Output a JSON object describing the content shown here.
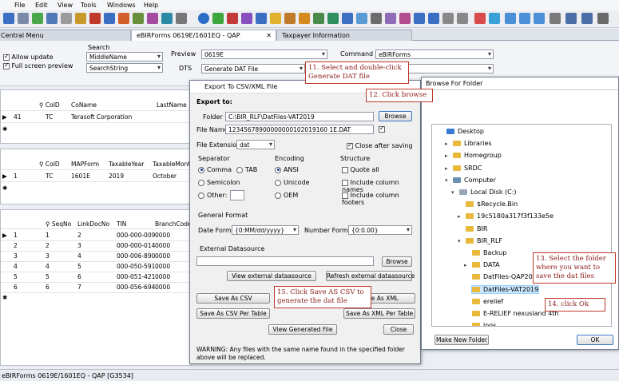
{
  "menu": [
    "File",
    "Edit",
    "View",
    "Tools",
    "Windows",
    "Help"
  ],
  "tabs": [
    "Central Menu",
    "eBIRForms 0619E/1601EQ - QAP",
    "Taxpayer Information"
  ],
  "filter": {
    "allow_update": "Allow update",
    "full_screen": "Full screen preview",
    "search_label": "Search",
    "search_field": "MiddleName",
    "search_string": "SearchString",
    "preview_label": "Preview",
    "preview_value": "0619E",
    "command_label": "Command",
    "command_value": "eBIRForms",
    "dts_label": "DTS",
    "dts_value": "Generate DAT File"
  },
  "grid1": {
    "headers": [
      "CoID",
      "CoName",
      "LastName"
    ],
    "rows": [
      [
        "41",
        "TC",
        "Terasoft Corporation"
      ]
    ]
  },
  "grid2": {
    "headers": [
      "CoID",
      "MAPForm",
      "TaxableYear",
      "TaxableMonth"
    ],
    "rows": [
      [
        "1",
        "TC",
        "1601E",
        "2019",
        "October"
      ]
    ]
  },
  "grid3": {
    "headers": [
      "SeqNo",
      "LinkDocNo",
      "TIN",
      "BranchCode"
    ],
    "rows": [
      [
        "1",
        "2",
        "000-000-009",
        "0000"
      ],
      [
        "2",
        "3",
        "000-000-014",
        "0000"
      ],
      [
        "3",
        "4",
        "000-006-890",
        "0000"
      ],
      [
        "4",
        "5",
        "000-050-591",
        "0000"
      ],
      [
        "5",
        "6",
        "000-051-421",
        "0000"
      ],
      [
        "6",
        "7",
        "000-056-694",
        "0000"
      ]
    ]
  },
  "export": {
    "title": "Export To CSV/XML File",
    "export_to": "Export to:",
    "folder_label": "Folder",
    "folder_value": "C:\\BIR_RLF\\DatFiles-VAT2019",
    "browse": "Browse",
    "filename_label": "File Name",
    "filename_value": "12345678900000000102019160 1E.DAT",
    "ext_label": "File Extension",
    "ext_value": "dat",
    "close_after": "Close after saving",
    "separator_label": "Separator",
    "comma": "Comma",
    "tab": "TAB",
    "semicolon": "Semicolon",
    "other": "Other:",
    "encoding_label": "Encoding",
    "ansi": "ANSI",
    "unicode": "Unicode",
    "oem": "OEM",
    "structure_label": "Structure",
    "quote_all": "Quote all",
    "col_names": "Include column names",
    "col_footers": "Include column footers",
    "general_format": "General Format",
    "date_format_label": "Date Format",
    "date_format_value": "{0:MM/dd/yyyy}",
    "number_format_label": "Number Format",
    "number_format_value": "{0:0.00}",
    "ext_ds": "External Datasource",
    "browse2": "Browse",
    "view_ext": "View external dataasource",
    "refresh_ext": "Refresh external dataasource",
    "save_csv": "Save As CSV",
    "save_xml": "Save As XML",
    "save_csv_table": "Save As CSV Per Table",
    "save_xml_table": "Save As XML Per Table",
    "view_generated": "View Generated File",
    "close": "Close",
    "warning": "WARNING: Any files with the same name found in the specified folder above will be replaced."
  },
  "browse_dialog": {
    "title": "Browse For Folder",
    "items": [
      "Desktop",
      "Libraries",
      "Homegroup",
      "SRDC",
      "Computer",
      "Local Disk (C:)",
      "$Recycle.Bin",
      "19c5180a317f3f133e5e",
      "BIR",
      "BIR_RLF",
      "Backup",
      "DATA",
      "DatFiles-QAP2019",
      "DatFiles-VAT2019",
      "erelief",
      "E-RELIEF nexusland 4th",
      "logs"
    ],
    "make_new": "Make New Folder",
    "ok": "OK"
  },
  "notes": {
    "n11": "11. Select and double-click Generate DAT file",
    "n12": "12. Click browse",
    "n13": "13. Select the folder where you want to save the dat files",
    "n14": "14. click Ok",
    "n15": "15. Click Save AS CSV to generate the dat file"
  },
  "status": "eBIRForms 0619E/1601EQ - QAP [G3534]",
  "colors": {
    "note_border": "#c0392b",
    "dialog_border": "#6f7b8f",
    "folder": "#e9b93c"
  }
}
